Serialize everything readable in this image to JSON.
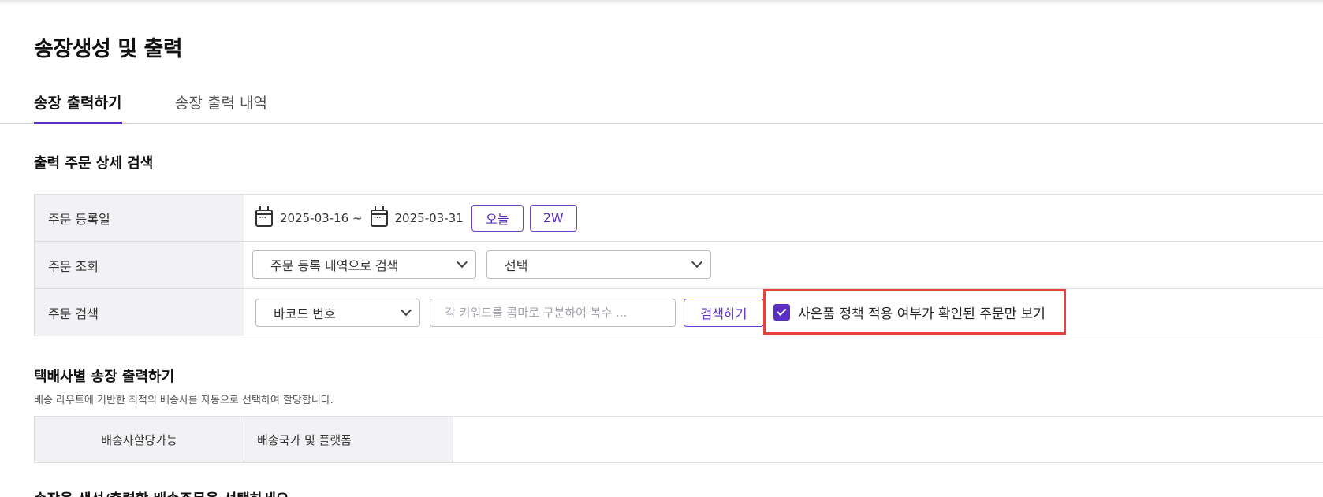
{
  "page": {
    "title": "송장생성 및 출력"
  },
  "tabs": [
    {
      "label": "송장 출력하기",
      "active": true
    },
    {
      "label": "송장 출력 내역",
      "active": false
    }
  ],
  "search_section": {
    "title": "출력 주문 상세 검색",
    "rows": {
      "order_date": {
        "label": "주문 등록일",
        "start_date": "2025-03-16 ~",
        "end_date": "2025-03-31",
        "quick_buttons": [
          "오늘",
          "2W"
        ]
      },
      "order_lookup": {
        "label": "주문 조회",
        "lookup_select": "주문 등록 내역으로 검색",
        "option_select": "선택"
      },
      "order_search": {
        "label": "주문 검색",
        "field_select": "바코드 번호",
        "keyword_placeholder": "각 키워드를 콤마로 구분하여 복수 ...",
        "search_button": "검색하기",
        "gift_filter_label": "사은품 정책 적용 여부가 확인된 주문만 보기",
        "gift_filter_checked": true
      }
    }
  },
  "carrier_section": {
    "title": "택배사별 송장 출력하기",
    "description": "배송 라우트에 기반한 최적의 배송사를 자동으로 선택하여 할당합니다.",
    "columns": [
      "배송사할당가능",
      "배송국가 및 플랫폼"
    ]
  },
  "next_section": {
    "title_partial": "송장을 생성/출력할 배송주문을 선택하세요"
  },
  "colors": {
    "accent": "#5a2fc2",
    "highlight": "#e8423f",
    "label_bg": "#f2f2f4"
  }
}
